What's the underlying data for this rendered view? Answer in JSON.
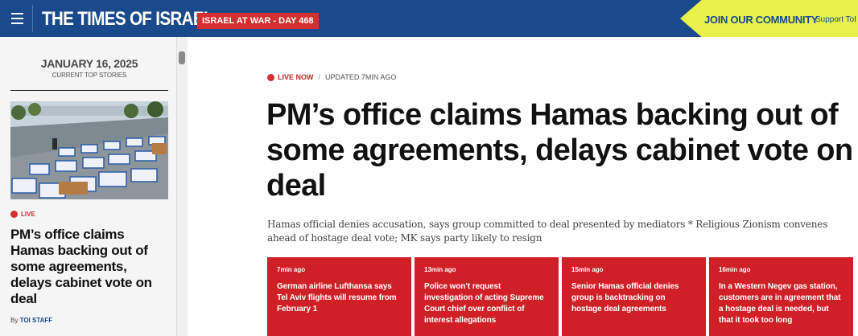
{
  "header": {
    "logo": "THE TIMES OF ISRAEL",
    "war_badge": "ISRAEL AT WAR - DAY 468",
    "community_title": "JOIN OUR COMMUNITY",
    "community_support": "Support ToI"
  },
  "sidebar": {
    "date": "JANUARY 16, 2025",
    "date_sub": "CURRENT TOP STORIES",
    "live_label": "LIVE",
    "headline": "PM’s office claims Hamas backing out of some agreements, delays cabinet vote on deal",
    "byline_prefix": "By",
    "byline_author": "TOI STAFF"
  },
  "main": {
    "live_label": "LIVE NOW",
    "separator": "/",
    "updated": "UPDATED 7MIN AGO",
    "headline": "PM’s office claims Hamas backing out of some agreements, delays cabinet vote on deal",
    "subhead": "Hamas official denies accusation, says group committed to deal presented by mediators * Religious Zionism convenes ahead of hostage deal vote; MK says party likely to resign"
  },
  "cards": [
    {
      "time": "7min ago",
      "text": "German airline Lufthansa says Tel Aviv flights will resume from February 1"
    },
    {
      "time": "13min ago",
      "text": "Police won’t request investigation of acting Supreme Court chief over conflict of interest allegations"
    },
    {
      "time": "15min ago",
      "text": "Senior Hamas official denies group is backtracking on hostage deal agreements"
    },
    {
      "time": "16min ago",
      "text": "In a Western Negev gas station, customers are in agreement that a hostage deal is needed, but that it took too long"
    }
  ],
  "colors": {
    "brand_blue": "#1b4a8c",
    "accent_red": "#d02027",
    "community_yellow": "#e8f04a"
  },
  "icons": {
    "menu": "hamburger-menu-icon",
    "live": "live-dot-icon"
  }
}
